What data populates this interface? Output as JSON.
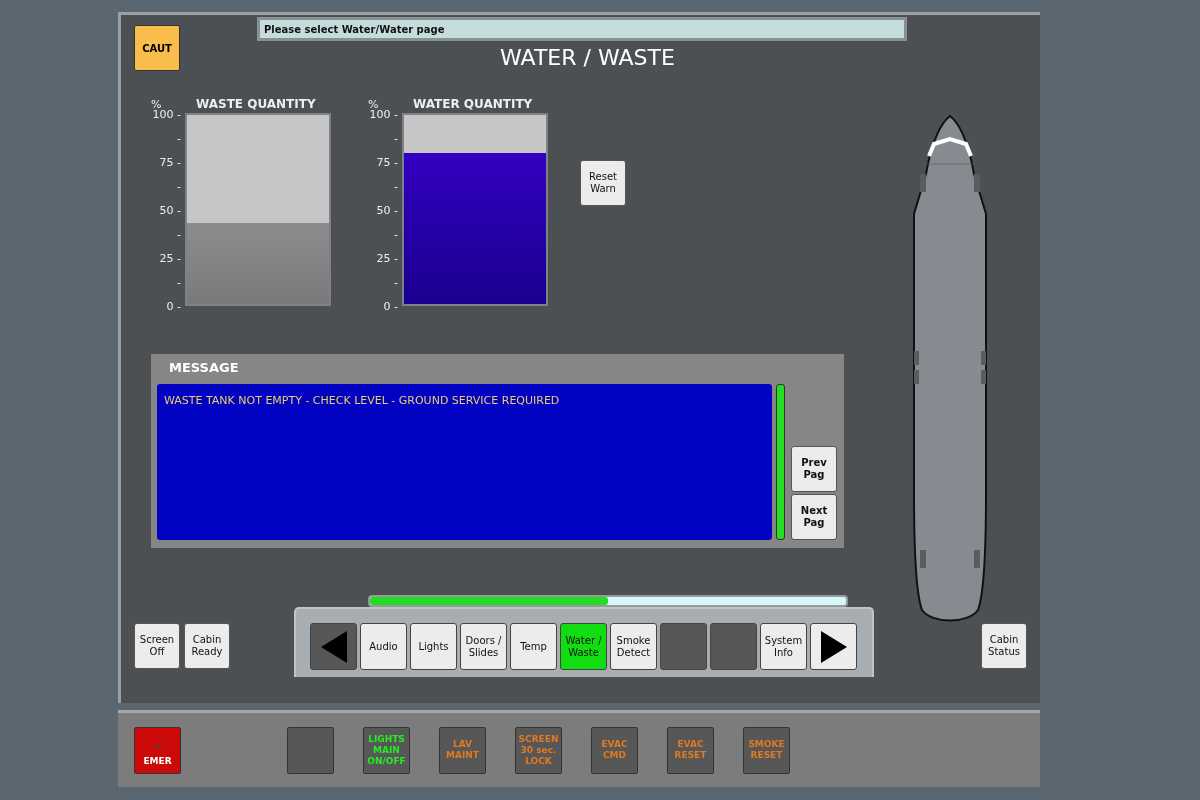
{
  "prompt": "Please select Water/Water page",
  "caution_button": "CAUT",
  "title": "WATER / WASTE",
  "gauges": [
    {
      "unit": "%",
      "title": "WASTE QUANTITY",
      "level": 0.43,
      "kind": "waste",
      "ticks": [
        "100 -",
        "-",
        "75 -",
        "-",
        "50 -",
        "-",
        "25 -",
        "-",
        "0 -"
      ]
    },
    {
      "unit": "%",
      "title": "WATER QUANTITY",
      "level": 0.8,
      "kind": "water",
      "ticks": [
        "100 -",
        "-",
        "75 -",
        "-",
        "50 -",
        "-",
        "25 -",
        "-",
        "0 -"
      ]
    }
  ],
  "reset_button": "Reset Warn",
  "message": {
    "heading": "MESSAGE",
    "lines": [
      "WASTE TANK NOT EMPTY - CHECK LEVEL - GROUND SERVICE REQUIRED"
    ],
    "prev": "Prev Pag",
    "next": "Next Pag"
  },
  "left_buttons": [
    "Screen Off",
    "Cabin Ready"
  ],
  "nav": {
    "level": 0.5,
    "items": [
      {
        "kind": "left"
      },
      {
        "kind": "page",
        "label": "Audio",
        "selected": false
      },
      {
        "kind": "page",
        "label": "Lights",
        "selected": false
      },
      {
        "kind": "page",
        "label": "Doors / Slides",
        "selected": false
      },
      {
        "kind": "page",
        "label": "Temp",
        "selected": false
      },
      {
        "kind": "page",
        "label": "Water / Waste",
        "selected": true
      },
      {
        "kind": "page",
        "label": "Smoke Detect",
        "selected": false
      },
      {
        "kind": "blank"
      },
      {
        "kind": "blank"
      },
      {
        "kind": "page",
        "label": "System Info",
        "selected": false
      },
      {
        "kind": "right"
      }
    ]
  },
  "right_button": "Cabin Status",
  "function_keys": [
    {
      "kind": "emergency",
      "label": "EMER"
    },
    {
      "kind": "blank"
    },
    {
      "kind": "active",
      "label": "LIGHTS MAIN ON/OFF"
    },
    {
      "kind": "inactive",
      "label": "LAV MAINT"
    },
    {
      "kind": "inactive",
      "label": "SCREEN 30 sec. LOCK"
    },
    {
      "kind": "inactive",
      "label": "EVAC CMD"
    },
    {
      "kind": "inactive",
      "label": "EVAC RESET"
    },
    {
      "kind": "inactive",
      "label": "SMOKE RESET"
    }
  ]
}
